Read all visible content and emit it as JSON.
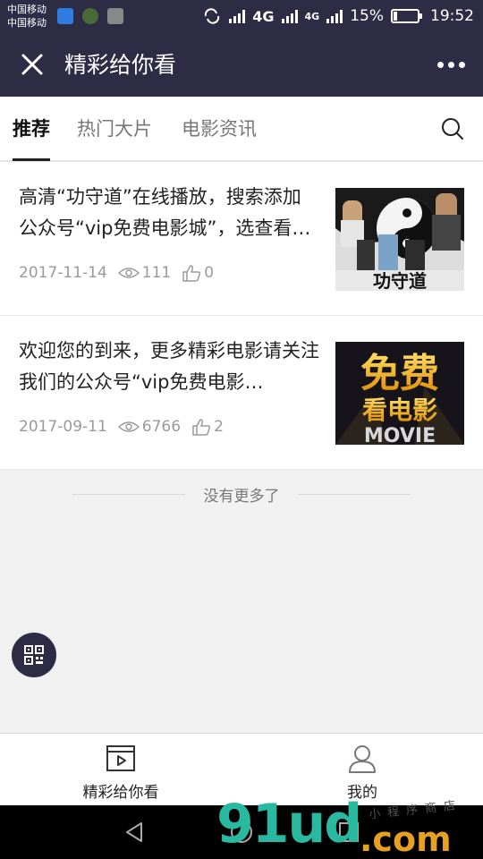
{
  "status_bar": {
    "carrier_1": "中国移动",
    "carrier_2": "中国移动",
    "net_1": "4G",
    "net_2": "4G",
    "battery": "15%",
    "battery_level": 0.15,
    "time": "19:52"
  },
  "title_bar": {
    "title": "精彩给你看"
  },
  "tabs": [
    {
      "label": "推荐",
      "active": true
    },
    {
      "label": "热门大片",
      "active": false
    },
    {
      "label": "电影资讯",
      "active": false
    }
  ],
  "articles": [
    {
      "title": "高清“功守道”在线播放，搜索添加公众号“vip免费电影城”，选查看…",
      "date": "2017-11-14",
      "views": "111",
      "likes": "0",
      "thumb_text": "功守道"
    },
    {
      "title": "欢迎您的到来，更多精彩电影请关注我们的公众号“vip免费电影…",
      "date": "2017-09-11",
      "views": "6766",
      "likes": "2",
      "thumb_text_1": "免费",
      "thumb_text_2": "看电影",
      "thumb_text_3": "MOVIE"
    }
  ],
  "no_more": "没有更多了",
  "bottom_nav": [
    {
      "label": "精彩给你看",
      "icon": "video-icon"
    },
    {
      "label": "我的",
      "icon": "person-icon"
    }
  ],
  "watermark": {
    "main": "91ud",
    "suffix": ".com",
    "tag": "小程序商店"
  },
  "colors": {
    "header_bg": "#2e2b45",
    "active_tab": "#111111",
    "meta_text": "#9a9a9a"
  }
}
